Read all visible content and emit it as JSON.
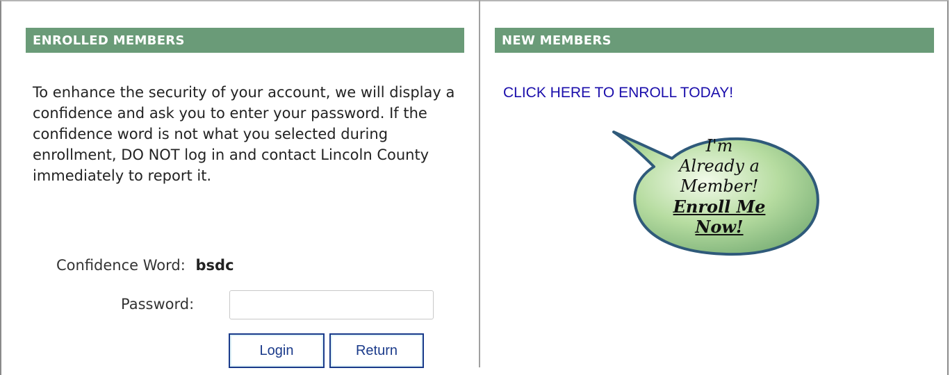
{
  "enrolled": {
    "header": "ENROLLED MEMBERS",
    "intro": "To enhance the security of your account, we will display a confidence and ask you to enter your password. If the confidence word is not what you selected during enrollment, DO NOT log in and contact Lincoln County immediately to report it.",
    "confidence_label": "Confidence Word:",
    "confidence_value": "bsdc",
    "password_label": "Password:",
    "password_value": "",
    "login_label": "Login",
    "return_label": "Return"
  },
  "new_members": {
    "header": "NEW MEMBERS",
    "enroll_link": "CLICK HERE TO ENROLL TODAY!",
    "bubble": {
      "line1": "I'm",
      "line2": "Already a",
      "line3": "Member!",
      "line4": "Enroll Me",
      "line5": "Now!",
      "fill": "#b6dca0",
      "stroke": "#2f5a7a"
    }
  }
}
